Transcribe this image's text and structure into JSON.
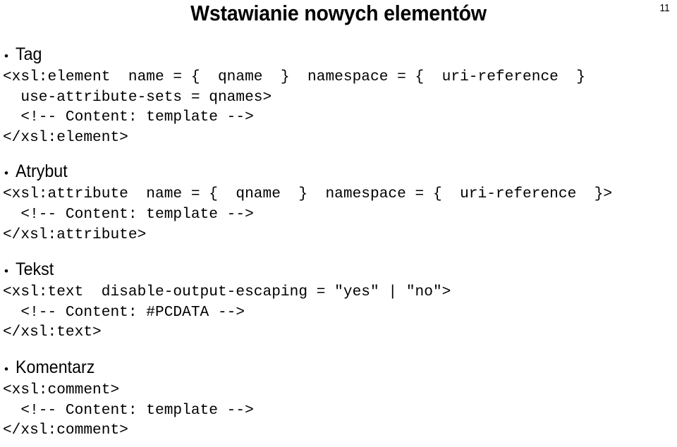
{
  "slide": {
    "title": "Wstawianie nowych elementów",
    "page_number": "11",
    "bullet_glyph": "•",
    "text_color": "#000000",
    "background_color": "#ffffff"
  },
  "sections": [
    {
      "heading": "Tag",
      "code": "<xsl:element  name = {  qname  }  namespace = {  uri-reference  }\n  use-attribute-sets = qnames>\n  <!-- Content: template -->\n</xsl:element>"
    },
    {
      "heading": "Atrybut",
      "code": "<xsl:attribute  name = {  qname  }  namespace = {  uri-reference  }>\n  <!-- Content: template -->\n</xsl:attribute>"
    },
    {
      "heading": "Tekst",
      "code": "<xsl:text  disable-output-escaping = \"yes\" | \"no\">\n  <!-- Content: #PCDATA -->\n</xsl:text>"
    },
    {
      "heading": "Komentarz",
      "code": "<xsl:comment>\n  <!-- Content: template -->\n</xsl:comment>"
    }
  ]
}
